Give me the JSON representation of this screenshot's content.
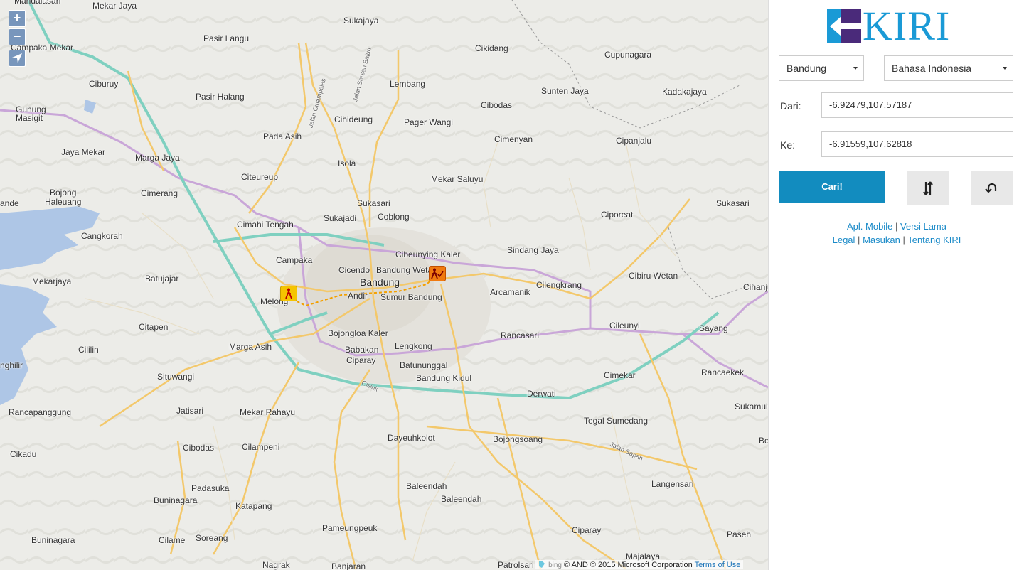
{
  "map": {
    "zoom_in": "+",
    "zoom_out": "−",
    "labels": [
      {
        "t": "Mekar Jaya"
      },
      {
        "t": "Sukajaya"
      },
      {
        "t": "Campaka Mekar"
      },
      {
        "t": "Pasir Langu"
      },
      {
        "t": "Cikidang"
      },
      {
        "t": "Cupunagara"
      },
      {
        "t": "Ciburuy"
      },
      {
        "t": "Lembang"
      },
      {
        "t": "Sunten Jaya"
      },
      {
        "t": "Kadakajaya"
      },
      {
        "t": "Pasir Halang"
      },
      {
        "t": "Cibodas"
      },
      {
        "t": "Gunung"
      },
      {
        "t": "Masigit"
      },
      {
        "t": "Cihideung"
      },
      {
        "t": "Pager Wangi"
      },
      {
        "t": "Pada Asih"
      },
      {
        "t": "Cimenyan"
      },
      {
        "t": "Cipanjalu"
      },
      {
        "t": "Jaya Mekar"
      },
      {
        "t": "Marga Jaya"
      },
      {
        "t": "Isola"
      },
      {
        "t": "Citeureup"
      },
      {
        "t": "Mekar Saluyu"
      },
      {
        "t": "Bojong"
      },
      {
        "t": "Haleuang"
      },
      {
        "t": "Cimerang"
      },
      {
        "t": "ande"
      },
      {
        "t": "Sukasari"
      },
      {
        "t": "Sukasari"
      },
      {
        "t": "Sukajadi"
      },
      {
        "t": "Coblong"
      },
      {
        "t": "Ciporeat"
      },
      {
        "t": "Cangkorah"
      },
      {
        "t": "Cimahi Tengah"
      },
      {
        "t": "Sindang Jaya"
      },
      {
        "t": "Cibeunying Kaler"
      },
      {
        "t": "Campaka"
      },
      {
        "t": "Cicendo"
      },
      {
        "t": "Bandung Wetan"
      },
      {
        "t": "Mekarjaya"
      },
      {
        "t": "Batujajar"
      },
      {
        "t": "Andir"
      },
      {
        "t": "Arcamanik"
      },
      {
        "t": "Cilengkrang"
      },
      {
        "t": "Cibiru Wetan"
      },
      {
        "t": "Cihanjuang"
      },
      {
        "t": "Melong"
      },
      {
        "t": "Sumur Bandung"
      },
      {
        "t": "Citapen"
      },
      {
        "t": "Bojongloa Kaler"
      },
      {
        "t": "Rancasari"
      },
      {
        "t": "Cileunyi"
      },
      {
        "t": "Sayang"
      },
      {
        "t": "Marga Asih"
      },
      {
        "t": "Babakan"
      },
      {
        "t": "Ciparay"
      },
      {
        "t": "Lengkong"
      },
      {
        "t": "Cililin"
      },
      {
        "t": "Batununggal"
      },
      {
        "t": "Bandung Kidul"
      },
      {
        "t": "Cimekar"
      },
      {
        "t": "Rancaekek"
      },
      {
        "t": "nghilir"
      },
      {
        "t": "Situwangi"
      },
      {
        "t": "Derwati"
      },
      {
        "t": "Sukamulya"
      },
      {
        "t": "Jatisari"
      },
      {
        "t": "Mekar Rahayu"
      },
      {
        "t": "Rancapanggung"
      },
      {
        "t": "Tegal Sumedang"
      },
      {
        "t": "Dayeuhkolot"
      },
      {
        "t": "Bojongsoang"
      },
      {
        "t": "Cikadu"
      },
      {
        "t": "Cibodas"
      },
      {
        "t": "Cilampeni"
      },
      {
        "t": "Bo"
      },
      {
        "t": "Langensari"
      },
      {
        "t": "Padasuka"
      },
      {
        "t": "Baleendah"
      },
      {
        "t": "Buninagara"
      },
      {
        "t": "Baleendah"
      },
      {
        "t": "Katapang"
      },
      {
        "t": "Pameungpeuk"
      },
      {
        "t": "Ciparay"
      },
      {
        "t": "Paseh"
      },
      {
        "t": "Buninagara"
      },
      {
        "t": "Cilame"
      },
      {
        "t": "Soreang"
      },
      {
        "t": "Majalaya"
      },
      {
        "t": "Nagrak"
      },
      {
        "t": "Banjaran"
      },
      {
        "t": "Patrolsari"
      },
      {
        "t": "Mandalasari"
      }
    ],
    "big_label": "Bandung",
    "road_labels": [
      "Jalan Cihampelas",
      "Jalan Sersan Bajuri",
      "Cisiuk",
      "Jalan Sapan"
    ],
    "attribution_prefix": "bing",
    "attribution_text": "© AND © 2015 Microsoft Corporation",
    "terms_link": "Terms of Use"
  },
  "panel": {
    "logo_text": "KIRI",
    "city_select": "Bandung",
    "language_select": "Bahasa Indonesia",
    "from_label": "Dari:",
    "from_value": "-6.92479,107.57187",
    "to_label": "Ke:",
    "to_value": "-6.91559,107.62818",
    "search_button": "Cari!",
    "links_row1": [
      "Apl. Mobile",
      "Versi Lama"
    ],
    "links_row2": [
      "Legal",
      "Masukan",
      "Tentang KIRI"
    ],
    "separator": "|"
  },
  "colors": {
    "accent": "#128cbf",
    "logo_blue": "#1a9ad6",
    "logo_purple": "#4a2a7a",
    "toll_road": "#7fd0c0",
    "main_road": "#f3c86b",
    "boundary": "#c9a6d8",
    "water": "#aec6e6"
  }
}
